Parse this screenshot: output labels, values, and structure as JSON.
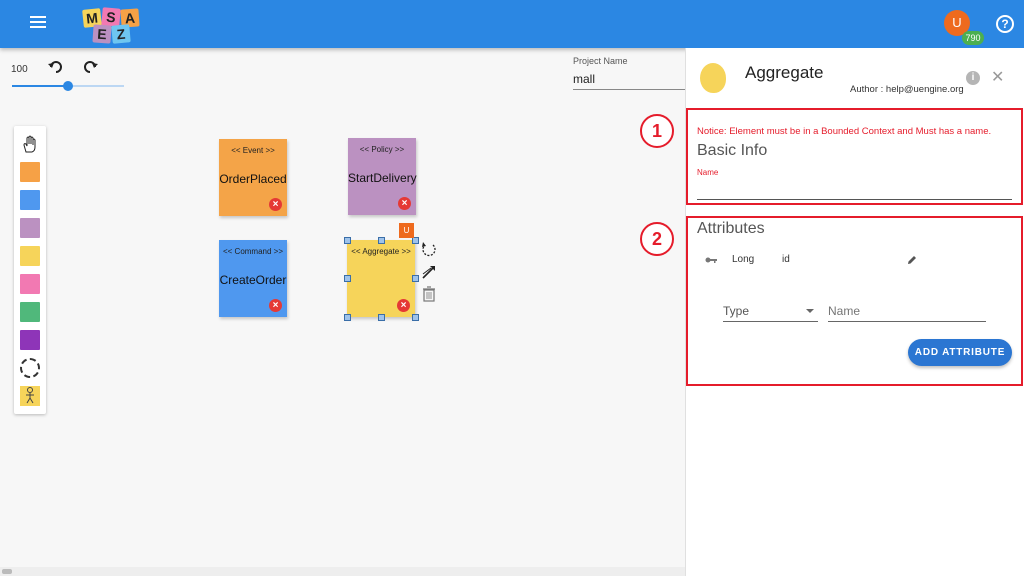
{
  "header": {
    "logo_letters": [
      "M",
      "S",
      "A",
      "E",
      "Z"
    ],
    "user_initial": "U",
    "coin_count": "790",
    "help_symbol": "?"
  },
  "canvas": {
    "zoom_value": "100",
    "zoom_fraction": 0.5,
    "project_label": "Project Name",
    "project_name": "mall"
  },
  "palette": {
    "items": [
      "hand-icon",
      "event-sticky",
      "command-sticky",
      "policy-sticky",
      "aggregate-sticky",
      "external-sticky",
      "readmodel-sticky",
      "issue-sticky",
      "bounded-context",
      "actor"
    ],
    "colors": [
      "#f6a146",
      "#4f98ef",
      "#bb91c1",
      "#f6d45a",
      "#f279b2",
      "#50b87b",
      "#8e35b8"
    ]
  },
  "stickies": [
    {
      "stereotype": "<< Event >>",
      "name": "OrderPlaced",
      "color": "#f4a448"
    },
    {
      "stereotype": "<< Policy >>",
      "name": "StartDelivery",
      "color": "#bb91c1"
    },
    {
      "stereotype": "<< Command >>",
      "name": "CreateOrder",
      "color": "#4f98ef"
    },
    {
      "stereotype": "<< Aggregate >>",
      "name": "",
      "color": "#f6d45a"
    }
  ],
  "selected_badge": "U",
  "panel": {
    "title": "Aggregate",
    "author": "Author : help@uengine.org",
    "notice": "Notice: Element must be in a Bounded Context and Must has a name.",
    "basic_info_title": "Basic Info",
    "name_label": "Name",
    "name_value": "",
    "attributes_title": "Attributes",
    "attributes": [
      {
        "type": "Long",
        "name": "id",
        "is_key": true
      }
    ],
    "new_attr_type_placeholder": "Type",
    "new_attr_name_placeholder": "Name",
    "add_button": "ADD ATTRIBUTE",
    "callouts": [
      "1",
      "2"
    ],
    "callout_color": "#e51c2b"
  },
  "colors": {
    "topbar": "#2b87e3",
    "accent": "#2b76d2"
  }
}
